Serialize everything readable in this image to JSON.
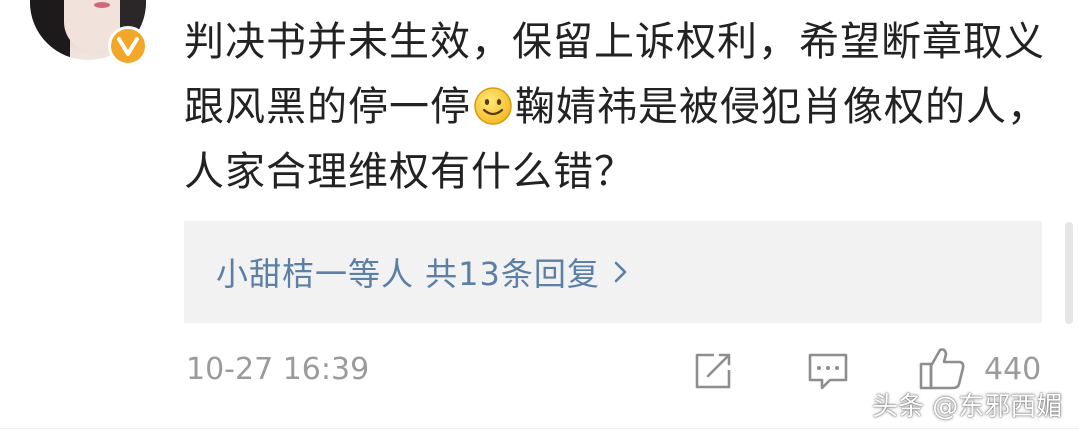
{
  "comment": {
    "text_before_emoji": "判决书并未生效，保留上诉权利，希望断章取义跟风黑的停一停",
    "text_after_emoji": "鞠婧祎是被侵犯肖像权的人，人家合理维权有什么错？",
    "emoji": "smile-emoji"
  },
  "replies": {
    "summary": "小甜桔一等人 共13条回复",
    "link_color": "#5b7fa5"
  },
  "footer": {
    "timestamp": "10-27 16:39",
    "like_count": "440"
  },
  "watermark": "头条 @东邪西媚",
  "colors": {
    "verified_badge": "#f2a728",
    "reply_bg": "#f2f2f2",
    "meta_text": "#9b9b9b"
  }
}
